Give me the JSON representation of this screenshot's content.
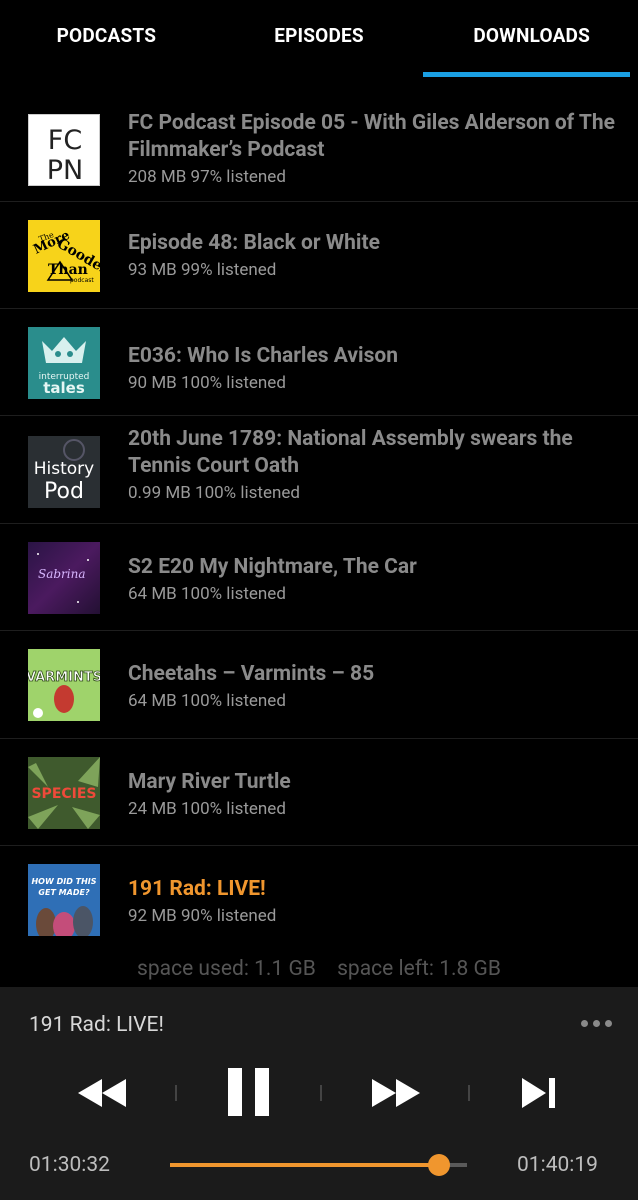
{
  "tabs": [
    {
      "label": "PODCASTS",
      "active": false
    },
    {
      "label": "EPISODES",
      "active": false
    },
    {
      "label": "DOWNLOADS",
      "active": true
    }
  ],
  "accent_colors": {
    "tab_indicator": "#1a9fe3",
    "playing": "#f0962e"
  },
  "episodes": [
    {
      "title": "FC Podcast Episode 05 - With Giles Alderson of The Filmmaker’s Podcast",
      "meta": "208 MB 97% listened",
      "art": "fcpn-logo"
    },
    {
      "title": "Episode 48: Black or White",
      "meta": "93 MB 99% listened",
      "art": "more-gooder-than-logo"
    },
    {
      "title": "E036: Who Is Charles Avison",
      "meta": "90 MB 100% listened",
      "art": "interrupted-tales-logo"
    },
    {
      "title": "20th June 1789: National Assembly swears the Tennis Court Oath",
      "meta": "0.99 MB 100% listened",
      "art": "history-pod-logo"
    },
    {
      "title": "S2 E20 My Nightmare, The Car",
      "meta": "64 MB 100% listened",
      "art": "sabrina-logo"
    },
    {
      "title": "Cheetahs – Varmints – 85",
      "meta": "64 MB 100% listened",
      "art": "varmints-logo"
    },
    {
      "title": "Mary River Turtle",
      "meta": "24 MB 100% listened",
      "art": "species-logo"
    },
    {
      "title": "191 Rad: LIVE!",
      "meta": "92 MB 90% listened",
      "art": "how-did-this-get-made-logo",
      "playing": true
    }
  ],
  "art_text": {
    "fcpn": [
      "FC",
      "PN"
    ],
    "more_gooder": [
      "The",
      "More",
      "Gooder",
      "Than",
      "podcast"
    ],
    "interrupted": [
      "interrupted",
      "tales"
    ],
    "history": [
      "History",
      "Pod"
    ],
    "sabrina": "Sabrina",
    "varmints": "VARMINTS",
    "species": "SPECIES",
    "hdtgm": [
      "HOW DID THIS",
      "GET MADE?"
    ]
  },
  "storage": {
    "used": "space used: 1.1 GB",
    "left": "space left: 1.8 GB"
  },
  "player": {
    "title": "191 Rad: LIVE!",
    "elapsed": "01:30:32",
    "remaining": "01:40:19",
    "progress": 0.905,
    "state": "playing"
  }
}
